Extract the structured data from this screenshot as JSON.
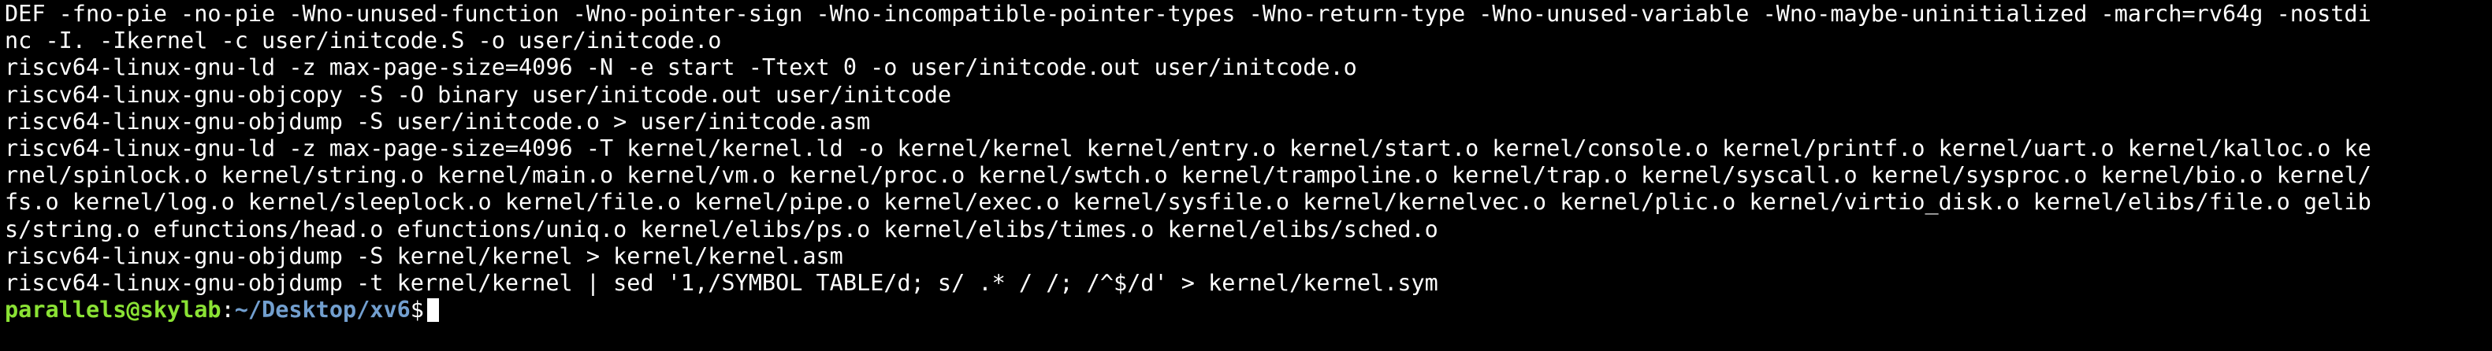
{
  "colors": {
    "background": "#000000",
    "text": "#ffffff",
    "prompt_user": "#8ae234",
    "prompt_path": "#729fcf"
  },
  "terminal": {
    "lines": [
      "DEF -fno-pie -no-pie -Wno-unused-function -Wno-pointer-sign -Wno-incompatible-pointer-types -Wno-return-type -Wno-unused-variable -Wno-maybe-uninitialized -march=rv64g -nostdi",
      "nc -I. -Ikernel -c user/initcode.S -o user/initcode.o",
      "riscv64-linux-gnu-ld -z max-page-size=4096 -N -e start -Ttext 0 -o user/initcode.out user/initcode.o",
      "riscv64-linux-gnu-objcopy -S -O binary user/initcode.out user/initcode",
      "riscv64-linux-gnu-objdump -S user/initcode.o > user/initcode.asm",
      "riscv64-linux-gnu-ld -z max-page-size=4096 -T kernel/kernel.ld -o kernel/kernel kernel/entry.o kernel/start.o kernel/console.o kernel/printf.o kernel/uart.o kernel/kalloc.o ke",
      "rnel/spinlock.o kernel/string.o kernel/main.o kernel/vm.o kernel/proc.o kernel/swtch.o kernel/trampoline.o kernel/trap.o kernel/syscall.o kernel/sysproc.o kernel/bio.o kernel/",
      "fs.o kernel/log.o kernel/sleeplock.o kernel/file.o kernel/pipe.o kernel/exec.o kernel/sysfile.o kernel/kernelvec.o kernel/plic.o kernel/virtio_disk.o kernel/elibs/file.o gelib",
      "s/string.o efunctions/head.o efunctions/uniq.o kernel/elibs/ps.o kernel/elibs/times.o kernel/elibs/sched.o",
      "riscv64-linux-gnu-objdump -S kernel/kernel > kernel/kernel.asm",
      "riscv64-linux-gnu-objdump -t kernel/kernel | sed '1,/SYMBOL TABLE/d; s/ .* / /; /^$/d' > kernel/kernel.sym"
    ],
    "prompt": {
      "user_host": "parallels@skylab",
      "separator": ":",
      "path": "~/Desktop/xv6",
      "symbol": "$"
    }
  }
}
